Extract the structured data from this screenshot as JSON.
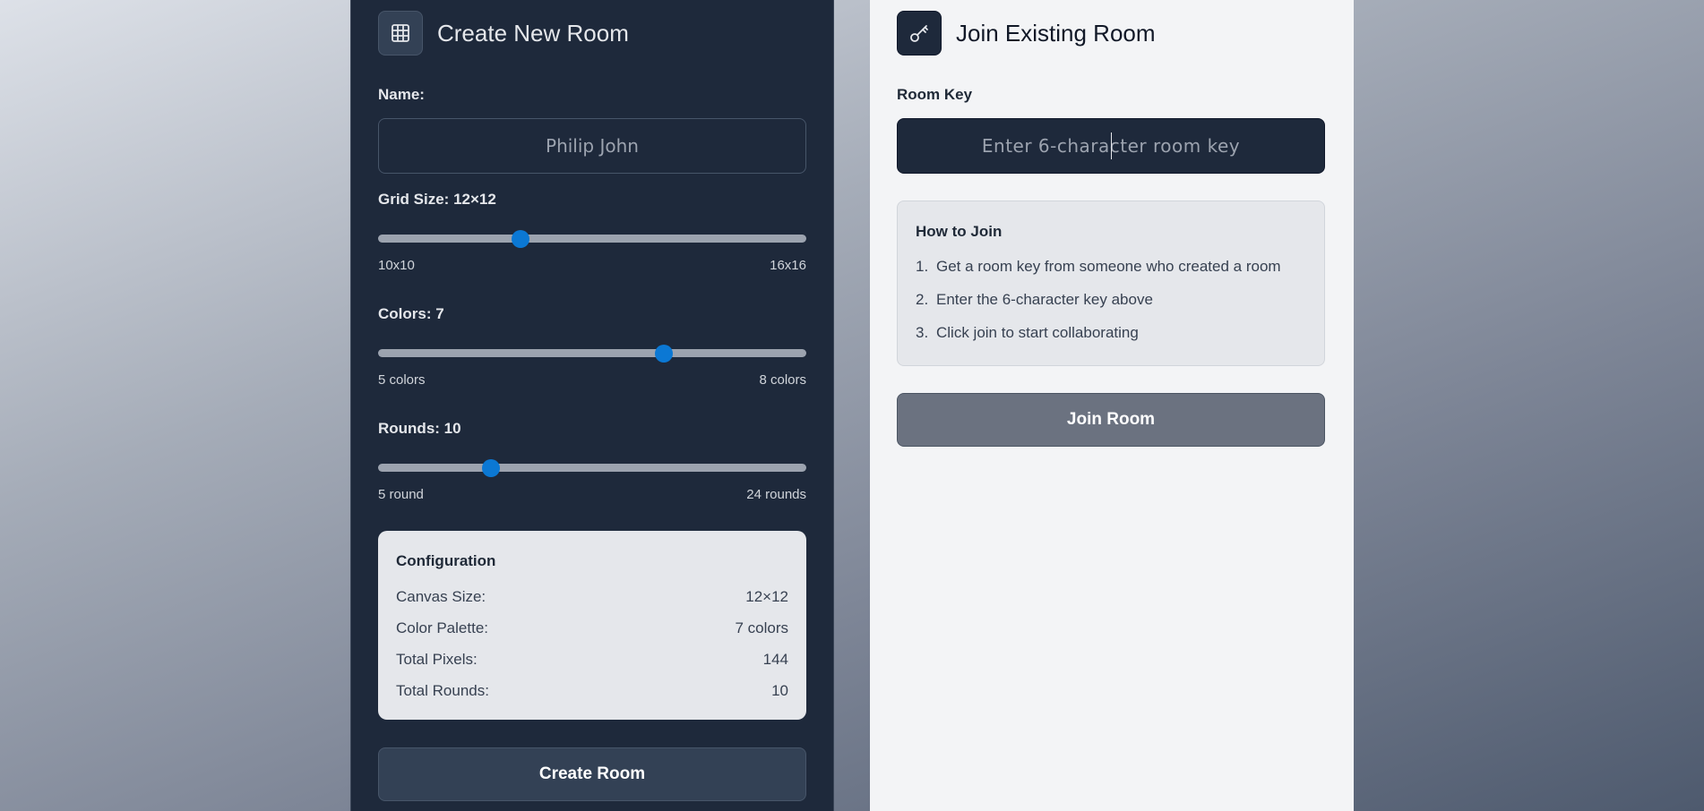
{
  "create": {
    "title": "Create New Room",
    "icon": "grid-icon",
    "name_label": "Name:",
    "name_value": "Philip John",
    "grid": {
      "label": "Grid Size: 12×12",
      "min_label": "10x10",
      "max_label": "16x16",
      "min": 10,
      "max": 16,
      "value": 12
    },
    "colors": {
      "label": "Colors: 7",
      "min_label": "5 colors",
      "max_label": "8 colors",
      "min": 5,
      "max": 8,
      "value": 7
    },
    "rounds": {
      "label": "Rounds: 10",
      "min_label": "5 round",
      "max_label": "24 rounds",
      "min": 5,
      "max": 24,
      "value": 10
    },
    "config": {
      "title": "Configuration",
      "rows": [
        {
          "key": "Canvas Size:",
          "value": "12×12"
        },
        {
          "key": "Color Palette:",
          "value": "7 colors"
        },
        {
          "key": "Total Pixels:",
          "value": "144"
        },
        {
          "key": "Total Rounds:",
          "value": "10"
        }
      ]
    },
    "button": "Create Room"
  },
  "join": {
    "title": "Join Existing Room",
    "icon": "key-icon",
    "key_label": "Room Key",
    "key_placeholder": "Enter 6-character room key",
    "howto": {
      "title": "How to Join",
      "steps": [
        {
          "num": "1.",
          "text": "Get a room key from someone who created a room"
        },
        {
          "num": "2.",
          "text": "Enter the 6-character key above"
        },
        {
          "num": "3.",
          "text": "Click join to start collaborating"
        }
      ]
    },
    "button": "Join Room"
  }
}
